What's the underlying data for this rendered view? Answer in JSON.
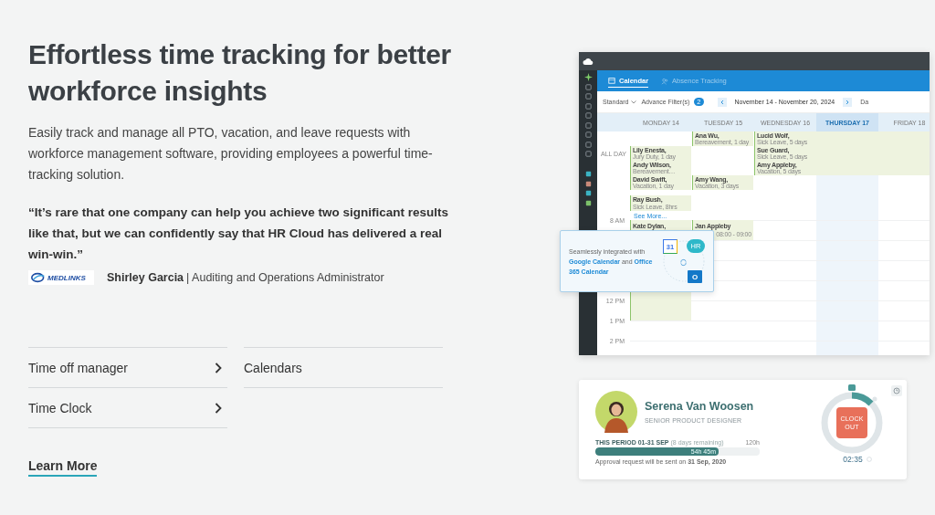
{
  "heading": "Effortless time tracking for better workforce insights",
  "description": "Easily track and manage all PTO, vacation, and leave requests with workforce management software, providing employees a powerful time-tracking solution.",
  "quote": "“It’s rare that one company can help you achieve two significant results like that, but we can confidently say that HR Cloud has delivered a real win-win.”",
  "author": {
    "logo_text": "MEDLINKS",
    "name": "Shirley Garcia",
    "role": "| Auditing and Operations Administrator"
  },
  "features": [
    {
      "label": "Time off manager",
      "chevron": true
    },
    {
      "label": "Calendars",
      "chevron": false
    },
    {
      "label": "Time Clock",
      "chevron": true
    }
  ],
  "learn_more": "Learn More",
  "calendar_app": {
    "tabs": [
      {
        "label": "Calendar",
        "selected": true
      },
      {
        "label": "Absence Tracking",
        "selected": false
      }
    ],
    "view": "Standard",
    "filter": "Advance Filter(s)",
    "filter_count": "2",
    "range": "November 14 - November 20, 2024",
    "cut_button": "Da",
    "all_day_label": "ALL DAY",
    "days": [
      {
        "label": "MONDAY 14",
        "selected": false,
        "all_day": [
          {
            "kind": "empty"
          },
          {
            "kind": "event",
            "name": "Lily Enesta,",
            "detail": "Jury Duty, 1 day",
            "continues": false
          },
          {
            "kind": "event",
            "name": "Andy Wilson,",
            "detail": "Bereavement…",
            "continues": false
          },
          {
            "kind": "event",
            "name": "David Swift,",
            "detail": "Vacation, 1 day",
            "continues": false
          }
        ],
        "early_event": {
          "name": "Ray Bush,",
          "detail": "Sick Leave, 8hrs"
        },
        "see_more": "See More...",
        "timed": [
          {
            "kind": "long",
            "name": "Kate Dylan,"
          }
        ]
      },
      {
        "label": "TUESDAY 15",
        "selected": false,
        "all_day": [
          {
            "kind": "event",
            "name": "Ana Wu,",
            "detail": "Bereavement, 1 day",
            "continues": false
          },
          {
            "kind": "empty"
          },
          {
            "kind": "empty"
          },
          {
            "kind": "event",
            "name": "Amy Wang,",
            "detail": "Vacation, 3 days",
            "continues": false
          }
        ],
        "timed": [
          {
            "kind": "short",
            "name": "Jan Appleby",
            "detail": "08:00 - 09:00"
          }
        ]
      },
      {
        "label": "WEDNESDAY 16",
        "selected": false,
        "all_day": [
          {
            "kind": "event",
            "name": "Lucid Wolf,",
            "detail": "Sick Leave, 5 days",
            "continues": true
          },
          {
            "kind": "event",
            "name": "Sue Guard,",
            "detail": "Sick Leave, 5 days",
            "continues": true
          },
          {
            "kind": "event",
            "name": "Amy Appleby,",
            "detail": "Vacation, 5 days",
            "continues": true
          }
        ]
      },
      {
        "label": "THURSDAY 17",
        "selected": true
      },
      {
        "label": "FRIDAY 18",
        "selected": false
      }
    ],
    "hours": [
      "8 AM",
      "12 PM",
      "1 PM",
      "2 PM"
    ],
    "popup": {
      "parts": [
        {
          "text": "Seamlessly integrated with ",
          "link": false
        },
        {
          "text": "Google Calendar",
          "link": true
        },
        {
          "text": " and ",
          "link": false
        },
        {
          "text": "Office 365 Calendar",
          "link": true
        }
      ],
      "google_badge": "31",
      "hr_badge": "HR",
      "outlook_badge": "O"
    }
  },
  "clock_card": {
    "name": "Serena Van Woosen",
    "title": "SENIOR PRODUCT DESIGNER",
    "period": "THIS PERIOD 01-31 SEP",
    "remaining": "(8 days remaining)",
    "total": "120h",
    "progress": {
      "level": 0.75,
      "reading": "54h 45m"
    },
    "note": "Approval request will be sent on **31 Sep, 2020**",
    "button": "CLOCK OUT",
    "timer": "02:35"
  }
}
